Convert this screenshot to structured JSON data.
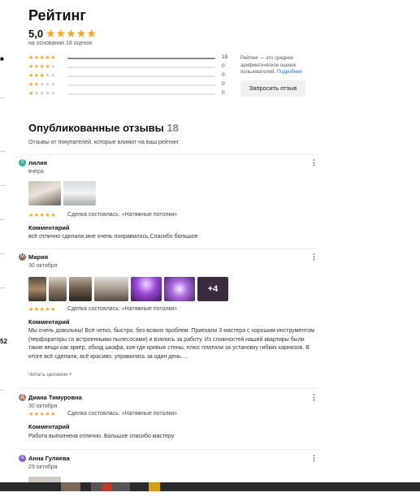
{
  "rating": {
    "title": "Рейтинг",
    "score": "5,0",
    "stars": "★★★★★",
    "basis": "на основании 18 оценок",
    "distribution": [
      {
        "stars": 5,
        "count": "18",
        "fraction": 1.0
      },
      {
        "stars": 4,
        "count": "0",
        "fraction": 0
      },
      {
        "stars": 3,
        "count": "0",
        "fraction": 0
      },
      {
        "stars": 2,
        "count": "0",
        "fraction": 0
      },
      {
        "stars": 1,
        "count": "0",
        "fraction": 0
      }
    ],
    "note": "Рейтинг — это среднее арифметическое оценок пользователей.",
    "note_link": "Подробнее",
    "ask_button": "Запросить отзыв"
  },
  "published": {
    "title": "Опубликованные отзывы",
    "count": "18",
    "subtitle": "Отзывы от покупателей, которые влияют на ваш рейтинг."
  },
  "side_text": "52",
  "reviews": [
    {
      "name": "лилия",
      "date": "вчера",
      "avatar_letter": "Л",
      "avatar_color": "#2bb5a0",
      "stars": "★★★★★",
      "deal": "Сделка состоялась: «Натяжные потолки»",
      "comment_label": "Комментарий",
      "comment": "всё отлично сделали,мне очень понравилось.Спасибо большое",
      "read_all": ""
    },
    {
      "name": "Мария",
      "date": "30 октября",
      "avatar_letter": "М",
      "avatar_color": "#8a6d5a",
      "stars": "★★★★★",
      "deal": "Сделка состоялась: «Натяжные потолки»",
      "comment_label": "Комментарий",
      "comment": "Мы очень довольны! Всё четко, быстро, без всяких проблем. Приехали 3 мастера с хорошим инструментом (перфораторы со встроенными пылесосами) и взялись за работу. Из сложностей нашей квартиры были такие вещи как эркер, обход шкафа, кое-где кривые стены, плюс платили за установку гибких карнизов. В итоге всё сделали, всё красиво, управились за один день.…",
      "read_all": "Читать целиком ˅",
      "more_photos": "+4"
    },
    {
      "name": "Диана Тимуровна",
      "date": "30 октября",
      "avatar_letter": "Д",
      "avatar_color": "#b07a5a",
      "stars": "★★★★★",
      "deal": "Сделка состоялась: «Натяжные потолки»",
      "comment_label": "Комментарий",
      "comment": "Работа выполнена отлично. Большое спасибо мастеру",
      "read_all": ""
    },
    {
      "name": "Анна Гуляева",
      "date": "29 октября",
      "avatar_letter": "А",
      "avatar_color": "#8a5cd6"
    }
  ],
  "icons": {
    "more": "more-vertical-icon",
    "star": "star-icon"
  },
  "colors": {
    "star": "#f5a623",
    "link": "#1a73e8"
  }
}
